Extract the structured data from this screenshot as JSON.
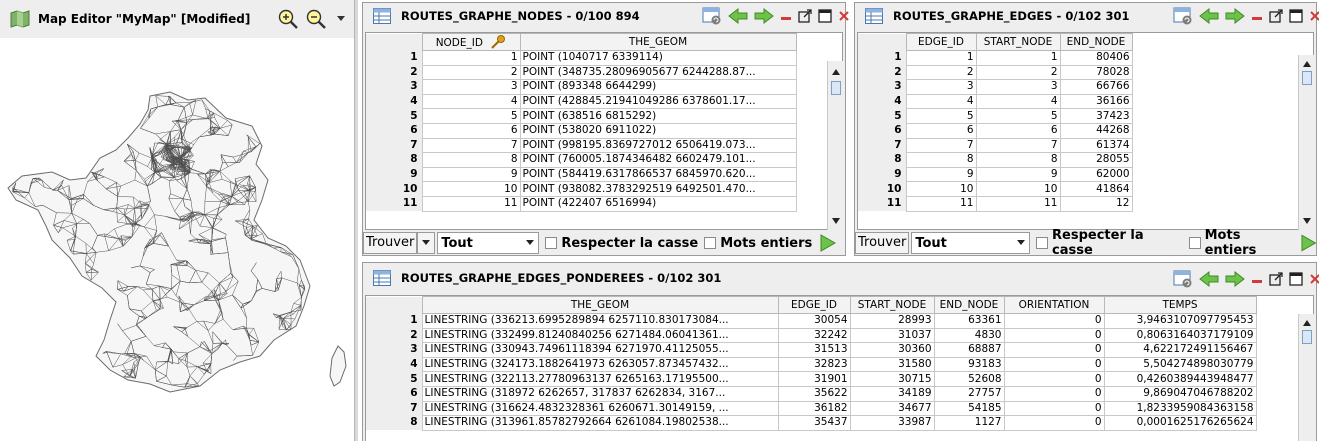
{
  "map": {
    "title": "Map Editor \"MyMap\" [Modified]",
    "icons": [
      "map-icon",
      "zoom-in-icon",
      "zoom-out-icon",
      "dropdown-icon"
    ]
  },
  "nodes_window": {
    "title": "ROUTES_GRAPHE_NODES - 0/100 894",
    "columns": [
      "NODE_ID",
      "THE_GEOM"
    ],
    "rows": [
      [
        "1",
        "1",
        "POINT (1040717 6339114)"
      ],
      [
        "2",
        "2",
        "POINT (348735.28096905677 6244288.87..."
      ],
      [
        "3",
        "3",
        "POINT (893348 6644299)"
      ],
      [
        "4",
        "4",
        "POINT (428845.21941049286 6378601.17..."
      ],
      [
        "5",
        "5",
        "POINT (638516 6815292)"
      ],
      [
        "6",
        "6",
        "POINT (538020 6911022)"
      ],
      [
        "7",
        "7",
        "POINT (998195.8369727012 6506419.073..."
      ],
      [
        "8",
        "8",
        "POINT (760005.1874346482 6602479.101..."
      ],
      [
        "9",
        "9",
        "POINT (584419.6317866537 6845970.620..."
      ],
      [
        "10",
        "10",
        "POINT (938082.3783292519 6492501.470..."
      ],
      [
        "11",
        "11",
        "POINT (422407 6516994)"
      ]
    ],
    "find_label": "Trouver",
    "find_scope": "Tout",
    "match_case": "Respecter la casse",
    "whole_words": "Mots entiers"
  },
  "edges_window": {
    "title": "ROUTES_GRAPHE_EDGES - 0/102 301",
    "columns": [
      "EDGE_ID",
      "START_NODE",
      "END_NODE"
    ],
    "rows": [
      [
        "1",
        "1",
        "1",
        "80406"
      ],
      [
        "2",
        "2",
        "2",
        "78028"
      ],
      [
        "3",
        "3",
        "3",
        "66766"
      ],
      [
        "4",
        "4",
        "4",
        "36166"
      ],
      [
        "5",
        "5",
        "5",
        "37423"
      ],
      [
        "6",
        "6",
        "6",
        "44268"
      ],
      [
        "7",
        "7",
        "7",
        "61374"
      ],
      [
        "8",
        "8",
        "8",
        "28055"
      ],
      [
        "9",
        "9",
        "9",
        "62000"
      ],
      [
        "10",
        "10",
        "10",
        "41864"
      ],
      [
        "11",
        "11",
        "11",
        "12"
      ]
    ],
    "find_label": "Trouver",
    "find_scope": "Tout",
    "match_case": "Respecter la casse",
    "whole_words": "Mots entiers"
  },
  "weighted_window": {
    "title": "ROUTES_GRAPHE_EDGES_PONDEREES - 0/102 301",
    "columns": [
      "THE_GEOM",
      "EDGE_ID",
      "START_NODE",
      "END_NODE",
      "ORIENTATION",
      "TEMPS"
    ],
    "rows": [
      [
        "1",
        "LINESTRING (336213.6995289894 6257110.830173084...",
        "30054",
        "28993",
        "63361",
        "0",
        "3,9463107097795453"
      ],
      [
        "2",
        "LINESTRING (332499.81240840256 6271484.06041361...",
        "32242",
        "31037",
        "4830",
        "0",
        "0,8063164037179109"
      ],
      [
        "3",
        "LINESTRING (330943.74961118394 6271970.41125055...",
        "31513",
        "30360",
        "68887",
        "0",
        "4,622172491156467"
      ],
      [
        "4",
        "LINESTRING (324173.1882641973 6263057.873457432...",
        "32823",
        "31580",
        "93183",
        "0",
        "5,504274898030779"
      ],
      [
        "5",
        "LINESTRING (322113.27780963137 6265163.17195500...",
        "31901",
        "30715",
        "52608",
        "0",
        "0,4260389443948477"
      ],
      [
        "6",
        "LINESTRING (318972 6262657, 317837 6262834, 3167...",
        "35622",
        "34189",
        "27757",
        "0",
        "9,869047046788202"
      ],
      [
        "7",
        "LINESTRING (316624.4832328361 6260671.30149159, ...",
        "36182",
        "34677",
        "54185",
        "0",
        "1,8233959084363158"
      ],
      [
        "8",
        "LINESTRING (313961.85782792664 6261084.19802538...",
        "35437",
        "33987",
        "1127",
        "0",
        "0,0001625176265624"
      ]
    ]
  }
}
